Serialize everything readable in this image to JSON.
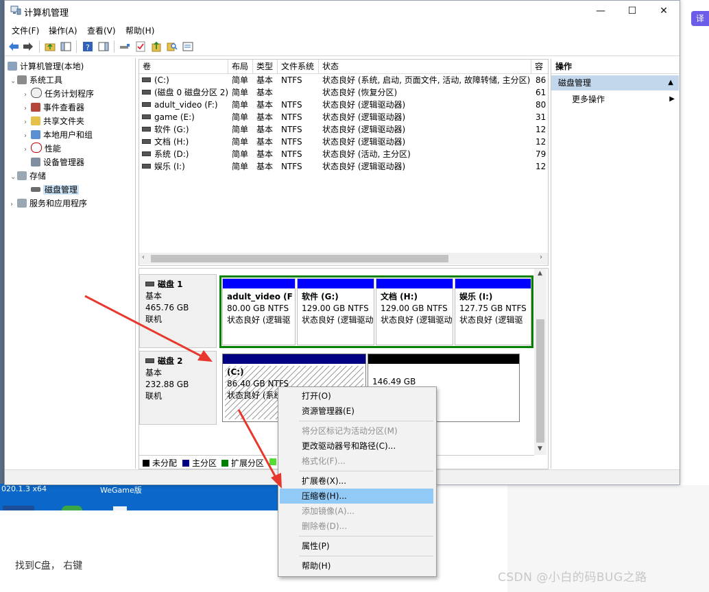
{
  "window": {
    "title": "计算机管理",
    "buttons": {
      "minimize": "—",
      "maximize": "☐",
      "close": "✕"
    }
  },
  "menu": [
    "文件(F)",
    "操作(A)",
    "查看(V)",
    "帮助(H)"
  ],
  "tree": {
    "root": "计算机管理(本地)",
    "system_tools": "系统工具",
    "task_scheduler": "任务计划程序",
    "event_viewer": "事件查看器",
    "shared_folders": "共享文件夹",
    "local_users": "本地用户和组",
    "performance": "性能",
    "device_manager": "设备管理器",
    "storage": "存储",
    "disk_management": "磁盘管理",
    "services": "服务和应用程序"
  },
  "volume_list": {
    "headers": [
      "卷",
      "布局",
      "类型",
      "文件系统",
      "状态",
      "容"
    ],
    "rows": [
      {
        "vol": "(C:)",
        "layout": "简单",
        "type": "基本",
        "fs": "NTFS",
        "status": "状态良好 (系统, 启动, 页面文件, 活动, 故障转储, 主分区)",
        "cap": "86"
      },
      {
        "vol": "(磁盘 0 磁盘分区 2)",
        "layout": "简单",
        "type": "基本",
        "fs": "",
        "status": "状态良好 (恢复分区)",
        "cap": "61"
      },
      {
        "vol": "adult_video (F:)",
        "layout": "简单",
        "type": "基本",
        "fs": "NTFS",
        "status": "状态良好 (逻辑驱动器)",
        "cap": "80"
      },
      {
        "vol": "game (E:)",
        "layout": "简单",
        "type": "基本",
        "fs": "NTFS",
        "status": "状态良好 (逻辑驱动器)",
        "cap": "31"
      },
      {
        "vol": "软件 (G:)",
        "layout": "简单",
        "type": "基本",
        "fs": "NTFS",
        "status": "状态良好 (逻辑驱动器)",
        "cap": "12"
      },
      {
        "vol": "文档 (H:)",
        "layout": "简单",
        "type": "基本",
        "fs": "NTFS",
        "status": "状态良好 (逻辑驱动器)",
        "cap": "12"
      },
      {
        "vol": "系统 (D:)",
        "layout": "简单",
        "type": "基本",
        "fs": "NTFS",
        "status": "状态良好 (活动, 主分区)",
        "cap": "79"
      },
      {
        "vol": "娱乐 (I:)",
        "layout": "简单",
        "type": "基本",
        "fs": "NTFS",
        "status": "状态良好 (逻辑驱动器)",
        "cap": "12"
      }
    ]
  },
  "disks": {
    "disk1": {
      "name": "磁盘 1",
      "kind": "基本",
      "size": "465.76 GB",
      "state": "联机",
      "partitions": [
        {
          "name": "adult_video (F",
          "size": "80.00 GB NTFS",
          "status": "状态良好 (逻辑驱"
        },
        {
          "name": "软件 (G:)",
          "size": "129.00 GB NTFS",
          "status": "状态良好 (逻辑驱动"
        },
        {
          "name": "文档 (H:)",
          "size": "129.00 GB NTFS",
          "status": "状态良好 (逻辑驱动"
        },
        {
          "name": "娱乐 (I:)",
          "size": "127.75 GB NTFS",
          "status": "状态良好 (逻辑驱"
        }
      ]
    },
    "disk2": {
      "name": "磁盘 2",
      "kind": "基本",
      "size": "232.88 GB",
      "state": "联机",
      "partitions": [
        {
          "name": "(C:)",
          "size": "86.40 GB NTFS",
          "status": "状态良好 (系统"
        },
        {
          "name": "",
          "size": "146.49 GB",
          "status": ""
        }
      ]
    }
  },
  "legend": [
    "未分配",
    "主分区",
    "扩展分区"
  ],
  "actions": {
    "header": "操作",
    "section": "磁盘管理",
    "more": "更多操作"
  },
  "context_menu": {
    "open": "打开(O)",
    "explorer": "资源管理器(E)",
    "mark_active": "将分区标记为活动分区(M)",
    "change_letter": "更改驱动器号和路径(C)...",
    "format": "格式化(F)...",
    "extend": "扩展卷(X)...",
    "shrink": "压缩卷(H)...",
    "mirror": "添加镜像(A)...",
    "delete": "删除卷(D)...",
    "properties": "属性(P)",
    "help": "帮助(H)"
  },
  "desktop": {
    "label_left": "020.1.3 x64",
    "label_right": "WeGame版",
    "translate_chip": "译"
  },
  "note": "找到C盘， 右键",
  "watermark": "CSDN @小白的码BUG之路",
  "colors": {
    "unallocated": "#000000",
    "primary": "#000080",
    "extended": "#008000",
    "logical": "#0000ff",
    "selection": "#91c9f7",
    "arrow": "#e8372c"
  }
}
